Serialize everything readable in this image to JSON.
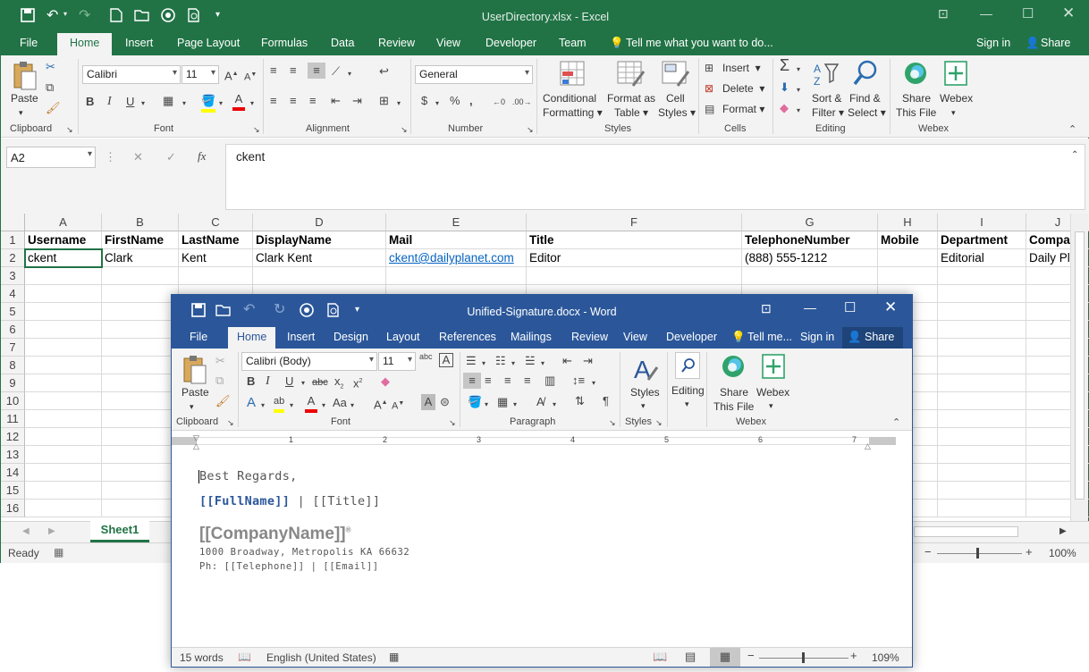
{
  "excel": {
    "title": "UserDirectory.xlsx - Excel",
    "tabs": [
      "File",
      "Home",
      "Insert",
      "Page Layout",
      "Formulas",
      "Data",
      "Review",
      "View",
      "Developer",
      "Team"
    ],
    "tell_me": "Tell me what you want to do...",
    "sign_in": "Sign in",
    "share": "Share",
    "ribbon": {
      "paste": "Paste",
      "font_name": "Calibri",
      "font_size": "11",
      "number_format": "General",
      "conditional": "Conditional",
      "formatting": "Formatting",
      "format_as": "Format as",
      "table": "Table",
      "cell": "Cell",
      "styles": "Styles",
      "insert": "Insert",
      "delete": "Delete",
      "format": "Format",
      "sort": "Sort &",
      "filter": "Filter",
      "find": "Find &",
      "select": "Select",
      "share_file_1": "Share",
      "share_file_2": "This File",
      "webex": "Webex",
      "groups": [
        "Clipboard",
        "Font",
        "Alignment",
        "Number",
        "Styles",
        "Cells",
        "Editing",
        "Webex"
      ]
    },
    "name_box": "A2",
    "formula": "ckent",
    "columns": [
      "A",
      "B",
      "C",
      "D",
      "E",
      "F",
      "G",
      "H",
      "I",
      "J"
    ],
    "rows": [
      "1",
      "2",
      "3",
      "4",
      "5",
      "6",
      "7",
      "8",
      "9",
      "10",
      "11",
      "12",
      "13",
      "14",
      "15",
      "16"
    ],
    "header_row": [
      "Username",
      "FirstName",
      "LastName",
      "DisplayName",
      "Mail",
      "Title",
      "TelephoneNumber",
      "Mobile",
      "Department",
      "Compan"
    ],
    "data_row": [
      "ckent",
      "Clark",
      "Kent",
      "Clark Kent",
      "ckent@dailyplanet.com",
      "Editor",
      "(888) 555-1212",
      "",
      "Editorial",
      "Daily Pla"
    ],
    "sheet_tab": "Sheet1",
    "status": "Ready",
    "zoom": "100%"
  },
  "word": {
    "title": "Unified-Signature.docx - Word",
    "tabs": [
      "File",
      "Home",
      "Insert",
      "Design",
      "Layout",
      "References",
      "Mailings",
      "Review",
      "View",
      "Developer"
    ],
    "tell_me": "Tell me...",
    "sign_in": "Sign in",
    "share": "Share",
    "ribbon": {
      "paste": "Paste",
      "font_name": "Calibri (Body)",
      "font_size": "11",
      "styles": "Styles",
      "editing": "Editing",
      "share_file_1": "Share",
      "share_file_2": "This File",
      "webex": "Webex",
      "groups": [
        "Clipboard",
        "Font",
        "Paragraph",
        "Styles",
        "Webex"
      ]
    },
    "ruler_numbers": [
      "1",
      "2",
      "3",
      "4",
      "5",
      "6",
      "7"
    ],
    "doc": {
      "line1": "Best Regards,",
      "fullname": "[[FullName]]",
      "sep_title": " | [[Title]]",
      "company": "[[CompanyName]]",
      "address": "1000 Broadway, Metropolis KA 66632",
      "phone": "Ph: [[Telephone]] | [[Email]]"
    },
    "status_words": "15 words",
    "status_lang": "English (United States)",
    "zoom": "109%"
  },
  "colors": {
    "excel_green": "#217346",
    "word_blue": "#2b579a",
    "link": "#0563c1"
  }
}
